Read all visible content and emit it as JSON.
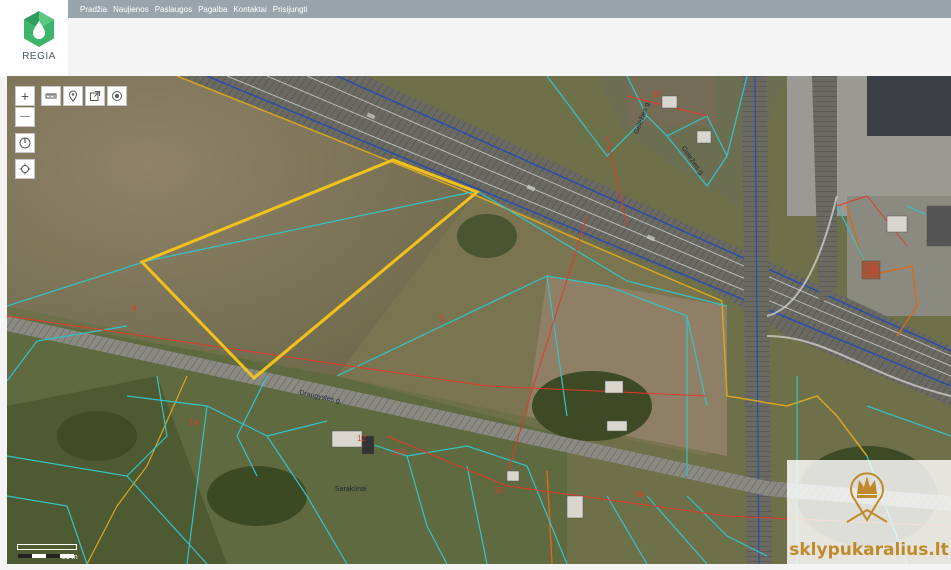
{
  "nav": {
    "items": [
      "Pradžia",
      "Naujienos",
      "Paslaugos",
      "Pagalba",
      "Kontaktai",
      "Prisijungti"
    ]
  },
  "logo": {
    "text": "REGIA"
  },
  "map": {
    "controls": {
      "zoom_in": "+",
      "zoom_out": "—"
    },
    "parcel_labels": [
      {
        "text": "9"
      },
      {
        "text": "5"
      },
      {
        "text": "14"
      },
      {
        "text": "12"
      },
      {
        "text": "12A"
      },
      {
        "text": "10"
      },
      {
        "text": "8A"
      },
      {
        "text": "19"
      },
      {
        "text": "30"
      }
    ],
    "street_labels": [
      "Draugystės g.",
      "Geležies g.",
      "Geležies g.",
      "Sarakūnai"
    ],
    "scale": "20 m"
  },
  "watermark": {
    "text": "sklypukaralius.lt"
  },
  "colors": {
    "topbar": "#9aa4ab",
    "parcel_highlight": "#f2c21b",
    "cadastre_line": "#35c2c8",
    "boundary_red": "#e03a2a",
    "watermark_gold": "#c08a2c"
  }
}
